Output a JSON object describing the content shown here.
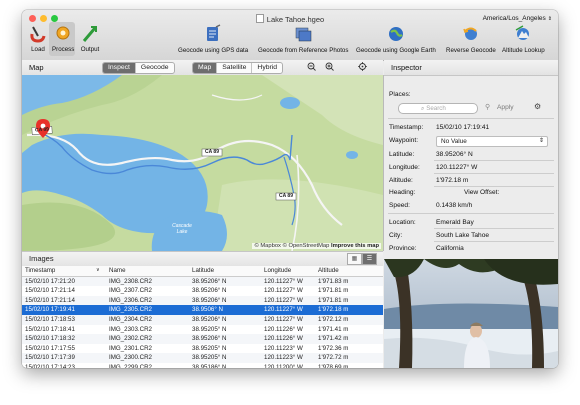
{
  "window": {
    "title": "Lake Tahoe.hgeo",
    "timezone": "America/Los_Angeles",
    "traffic_light_colors": [
      "#fe5f57",
      "#febc2e",
      "#28c840"
    ]
  },
  "toolbar": {
    "left_tools": [
      {
        "label": "Load",
        "icon": "load-icon",
        "selected": false
      },
      {
        "label": "Process",
        "icon": "process-icon",
        "selected": true
      },
      {
        "label": "Output",
        "icon": "output-icon",
        "selected": false
      }
    ],
    "right_tools": [
      {
        "label": "Geocode using GPS data",
        "icon": "gps-geocode-icon"
      },
      {
        "label": "Geocode from Reference Photos",
        "icon": "reference-photos-icon"
      },
      {
        "label": "Geocode using Google Earth",
        "icon": "google-earth-icon"
      },
      {
        "label": "Reverse Geocode",
        "icon": "reverse-geocode-icon"
      },
      {
        "label": "Altitude Lookup",
        "icon": "altitude-lookup-icon"
      }
    ]
  },
  "map_pane": {
    "title": "Map",
    "mode_tabs": [
      {
        "label": "Inspect",
        "active": true
      },
      {
        "label": "Geocode",
        "active": false
      }
    ],
    "map_types": [
      {
        "label": "Map",
        "active": true
      },
      {
        "label": "Satellite",
        "active": false
      },
      {
        "label": "Hybrid",
        "active": false
      }
    ],
    "zoom_out_icon": "zoom-out-icon",
    "zoom_in_icon": "zoom-in-icon",
    "locate_icon": "locate-icon",
    "attribution_prefix": "© Mapbox © OpenStreetMap",
    "attribution_link": "Improve this map",
    "road_labels": [
      "CA 89",
      "CA 89",
      "CA 89"
    ],
    "lake_label": "Cascade Lake",
    "marker_color": "#e8312a",
    "track_color": "#4a88d8"
  },
  "images": {
    "title": "Images",
    "columns": [
      "Timestamp",
      "Name",
      "Latitude",
      "Longitude",
      "Altitude"
    ],
    "selected_index": 3,
    "rows": [
      [
        "15/02/10 17:21:20",
        "IMG_2308.CR2",
        "38.95206° N",
        "120.11227° W",
        "1'971.83 m"
      ],
      [
        "15/02/10 17:21:14",
        "IMG_2307.CR2",
        "38.95206° N",
        "120.11227° W",
        "1'971.81 m"
      ],
      [
        "15/02/10 17:21:14",
        "IMG_2306.CR2",
        "38.95206° N",
        "120.11227° W",
        "1'971.81 m"
      ],
      [
        "15/02/10 17:19:41",
        "IMG_2305.CR2",
        "38.9506° N",
        "120.11227° W",
        "1'972.18 m"
      ],
      [
        "15/02/10 17:18:53",
        "IMG_2304.CR2",
        "38.95206° N",
        "120.11227° W",
        "1'972.12 m"
      ],
      [
        "15/02/10 17:18:41",
        "IMG_2303.CR2",
        "38.95205° N",
        "120.11226° W",
        "1'971.41 m"
      ],
      [
        "15/02/10 17:18:32",
        "IMG_2302.CR2",
        "38.95206° N",
        "120.11226° W",
        "1'971.42 m"
      ],
      [
        "15/02/10 17:17:55",
        "IMG_2301.CR2",
        "38.95205° N",
        "120.11223° W",
        "1'972.36 m"
      ],
      [
        "15/02/10 17:17:39",
        "IMG_2300.CR2",
        "38.95205° N",
        "120.11223° W",
        "1'972.72 m"
      ],
      [
        "15/02/10 17:14:23",
        "IMG_2299.CR2",
        "38.95186° N",
        "120.11200° W",
        "1'978.69 m"
      ]
    ]
  },
  "inspector": {
    "title": "Inspector",
    "places_label": "Places:",
    "search_placeholder": "Search",
    "apply_label": "Apply",
    "fields": [
      {
        "label": "Timestamp:",
        "value": "15/02/10 17:19:41"
      },
      {
        "label": "Waypoint:",
        "value": "No Value"
      },
      {
        "label": "Latitude:",
        "value": "38.95206° N"
      },
      {
        "label": "Longitude:",
        "value": "120.11227° W"
      },
      {
        "label": "Altitude:",
        "value": "1'972.18 m"
      },
      {
        "label": "Heading:",
        "value": "View Offset:"
      },
      {
        "label": "Speed:",
        "value": "0.1438 km/h"
      }
    ],
    "location": [
      {
        "label": "Location:",
        "value": "Emerald Bay"
      },
      {
        "label": "City:",
        "value": "South Lake Tahoe"
      },
      {
        "label": "Province:",
        "value": "California"
      }
    ]
  }
}
